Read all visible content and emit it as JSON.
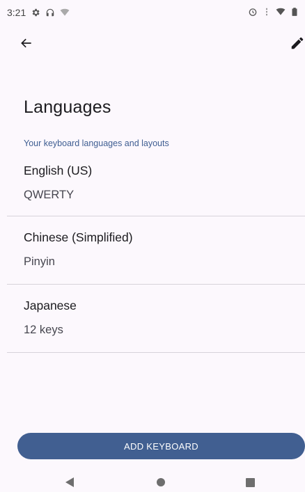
{
  "status_bar": {
    "time": "3:21",
    "left_icons": [
      "gear-icon",
      "headphones-icon",
      "wifi-icon"
    ],
    "right_icons": [
      "alarm-icon",
      "vpn-key-icon",
      "signal-icon",
      "battery-icon"
    ]
  },
  "app_bar": {
    "back_icon": "arrow-left-icon",
    "edit_icon": "pencil-icon"
  },
  "page": {
    "title": "Languages",
    "section_header": "Your keyboard languages and layouts"
  },
  "languages": [
    {
      "name": "English (US)",
      "layout": "QWERTY"
    },
    {
      "name": "Chinese (Simplified)",
      "layout": "Pinyin"
    },
    {
      "name": "Japanese",
      "layout": "12 keys"
    }
  ],
  "actions": {
    "add_keyboard_label": "ADD KEYBOARD"
  },
  "colors": {
    "accent": "#415f91",
    "section_header": "#3f5e92",
    "background": "#fcf8fd"
  }
}
